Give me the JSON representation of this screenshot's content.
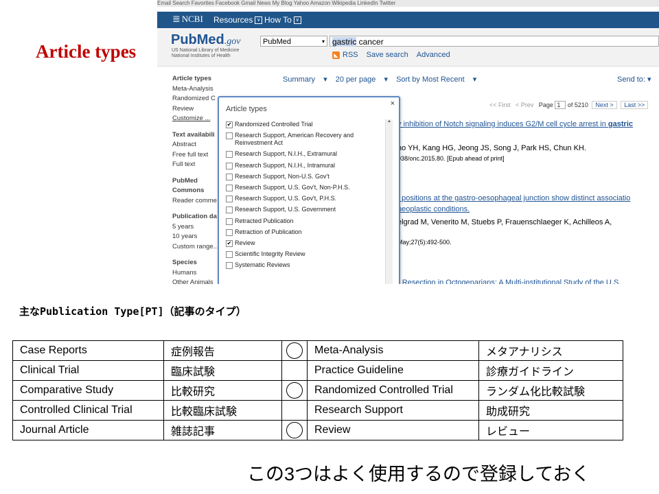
{
  "slide_label": "Article types",
  "browser": {
    "bookmarks_text": "Email  Search  Favorites  Facebook  Gmail  News  My Blog  Yahoo  Amazon  Wikipedia  LinkedIn  Twitter"
  },
  "ncbi": {
    "logo": "NCBI",
    "menu_resources": "Resources",
    "menu_howto": "How To"
  },
  "pubmed": {
    "logo_main": "PubMed",
    "logo_gov": ".gov",
    "sub1": "US National Library of Medicine",
    "sub2": "National Institutes of Health",
    "database": "PubMed",
    "query_highlight": "gastric",
    "query_rest": " cancer",
    "rss": "RSS",
    "save_search": "Save search",
    "advanced": "Advanced"
  },
  "sidebar": {
    "article_types_head": "Article types",
    "items": [
      "Meta-Analysis",
      "Randomized C",
      "Review"
    ],
    "customize": "Customize ...",
    "text_avail_head": "Text availabili",
    "text_items": [
      "Abstract",
      "Free full text",
      "Full text"
    ],
    "commons_head1": "PubMed",
    "commons_head2": "Commons",
    "commons_item": "Reader comme",
    "pubdate_head": "Publication da",
    "pubdate_items": [
      "5 years",
      "10 years",
      "Custom range..."
    ],
    "species_head": "Species",
    "species_items": [
      "Humans",
      "Other Animals"
    ]
  },
  "toolbar": {
    "summary": "Summary",
    "per_page": "20 per page",
    "sort": "Sort by Most Recent",
    "send_to": "Send to:"
  },
  "pager": {
    "first": "<< First",
    "prev": "< Prev",
    "page_label": "Page",
    "page_value": "1",
    "of": "of 5210",
    "next": "Next >",
    "last": "Last >>"
  },
  "results": [
    {
      "title": "y inhibition of Notch signaling induces G2/M cell cycle arrest in ",
      "title_bold": "gastric"
    },
    {
      "authors": "ho YH, Kang HG, Jeong JS, Song J, Park HS, Chun KH."
    },
    {
      "cite": "038/onc.2015.80. [Epub ahead of print]"
    },
    {
      "title": "t positions at the gastro-oesophageal junction show distinct associatio"
    },
    {
      "title": "neoplastic conditions."
    },
    {
      "authors": "elgrad M, Venerito M, Stuebs P, Frauenschlaeger K, Achilleos A,"
    },
    {
      "cite": "May;27(5):492-500."
    },
    {
      "title": "r Resection in Octogenarians: A Multi-institutional Study of the U.S."
    }
  ],
  "popup": {
    "title": "Article types",
    "close": "×",
    "options": [
      {
        "label": "Randomized Controlled Trial",
        "checked": true
      },
      {
        "label": "Research Support, American Recovery and Reinvestment Act",
        "checked": false
      },
      {
        "label": "Research Support, N.I.H., Extramural",
        "checked": false
      },
      {
        "label": "Research Support, N.I.H., Intramural",
        "checked": false
      },
      {
        "label": "Research Support, Non-U.S. Gov't",
        "checked": false
      },
      {
        "label": "Research Support, U.S. Gov't, Non-P.H.S.",
        "checked": false
      },
      {
        "label": "Research Support, U.S. Gov't, P.H.S.",
        "checked": false
      },
      {
        "label": "Research Support, U.S. Government",
        "checked": false
      },
      {
        "label": "Retracted Publication",
        "checked": false
      },
      {
        "label": "Retraction of Publication",
        "checked": false
      },
      {
        "label": "Review",
        "checked": true
      },
      {
        "label": "Scientific Integrity Review",
        "checked": false
      },
      {
        "label": "Systematic Reviews",
        "checked": false
      }
    ]
  },
  "pt_heading": "主なPublication Type[PT]（記事のタイプ）",
  "pt_table": [
    {
      "en1": "Case Reports",
      "ja1": "症例報告",
      "mark": true,
      "en2": "Meta-Analysis",
      "ja2": "メタアナリシス"
    },
    {
      "en1": "Clinical Trial",
      "ja1": "臨床試験",
      "mark": false,
      "en2": "Practice Guideline",
      "ja2": "診療ガイドライン"
    },
    {
      "en1": "Comparative Study",
      "ja1": "比較研究",
      "mark": true,
      "en2": "Randomized Controlled Trial",
      "ja2": "ランダム化比較試験"
    },
    {
      "en1": "Controlled Clinical Trial",
      "ja1": "比較臨床試験",
      "mark": false,
      "en2": "Research Support",
      "ja2": "助成研究"
    },
    {
      "en1": "Journal Article",
      "ja1": "雑誌記事",
      "mark": true,
      "en2": "Review",
      "ja2": "レビュー"
    }
  ],
  "footer_note": "この3つはよく使用するので登録しておく"
}
